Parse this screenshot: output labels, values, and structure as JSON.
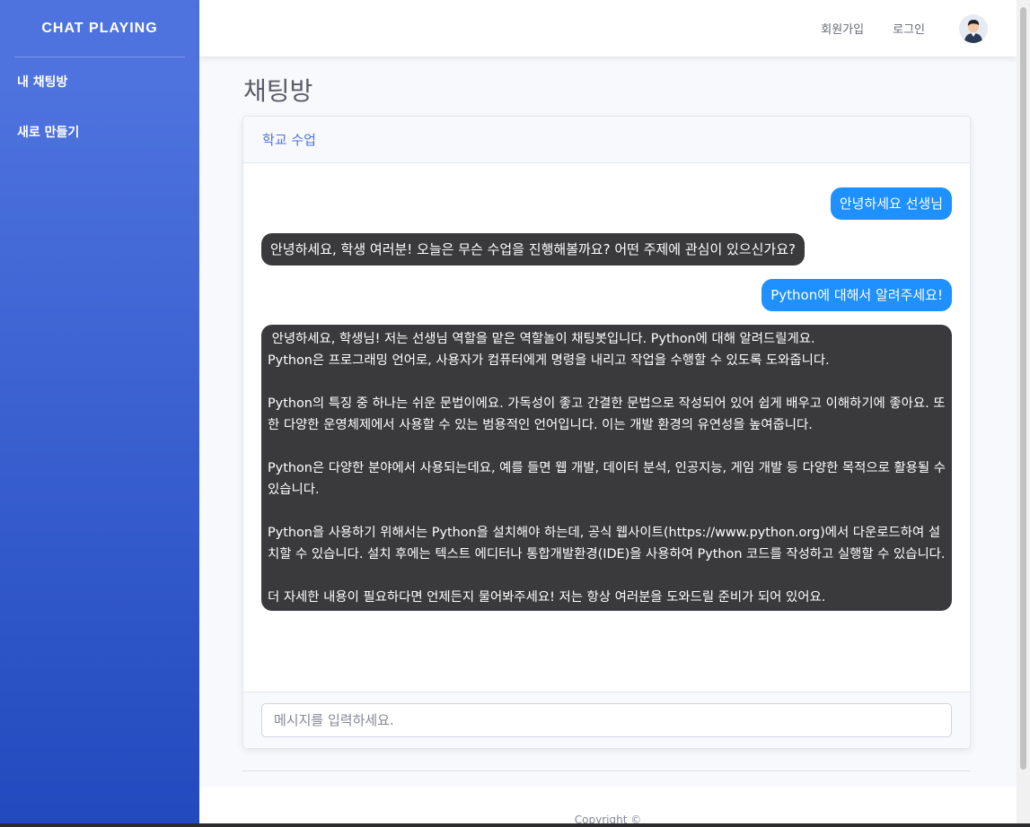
{
  "sidebar": {
    "brand": "CHAT PLAYING",
    "items": [
      {
        "label": "내 채팅방"
      },
      {
        "label": "새로 만들기"
      }
    ]
  },
  "topbar": {
    "signup": "회원가입",
    "login": "로그인",
    "avatar_icon": "user-avatar-icon"
  },
  "page": {
    "title": "채팅방"
  },
  "chat": {
    "room_name": "학교 수업",
    "messages": [
      {
        "sender": "user",
        "text": "안녕하세요 선생님"
      },
      {
        "sender": "bot",
        "text": "안녕하세요, 학생 여러분! 오늘은 무슨 수업을 진행해볼까요? 어떤 주제에 관심이 있으신가요?"
      },
      {
        "sender": "user",
        "text": "Python에 대해서 알려주세요!"
      },
      {
        "sender": "bot",
        "text": " 안녕하세요, 학생님! 저는 선생님 역할을 맡은 역할놀이 채팅봇입니다. Python에 대해 알려드릴게요.\nPython은 프로그래밍 언어로, 사용자가 컴퓨터에게 명령을 내리고 작업을 수행할 수 있도록 도와줍니다.\n\nPython의 특징 중 하나는 쉬운 문법이에요. 가독성이 좋고 간결한 문법으로 작성되어 있어 쉽게 배우고 이해하기에 좋아요. 또한 다양한 운영체제에서 사용할 수 있는 범용적인 언어입니다. 이는 개발 환경의 유연성을 높여줍니다.\n\nPython은 다양한 분야에서 사용되는데요, 예를 들면 웹 개발, 데이터 분석, 인공지능, 게임 개발 등 다양한 목적으로 활용될 수 있습니다.\n\nPython을 사용하기 위해서는 Python을 설치해야 하는데, 공식 웹사이트(https://www.python.org)에서 다운로드하여 설치할 수 있습니다. 설치 후에는 텍스트 에디터나 통합개발환경(IDE)을 사용하여 Python 코드를 작성하고 실행할 수 있습니다.\n\n더 자세한 내용이 필요하다면 언제든지 물어봐주세요! 저는 항상 여러분을 도와드릴 준비가 되어 있어요."
      }
    ],
    "input_placeholder": "메시지를 입력하세요."
  },
  "footer": {
    "copyright": "Copyright ©"
  },
  "colors": {
    "sidebar_top": "#4e73df",
    "sidebar_bottom": "#224abe",
    "user_bubble": "#1e90ff",
    "bot_bubble": "#3a3a3c",
    "accent": "#4e73df"
  }
}
